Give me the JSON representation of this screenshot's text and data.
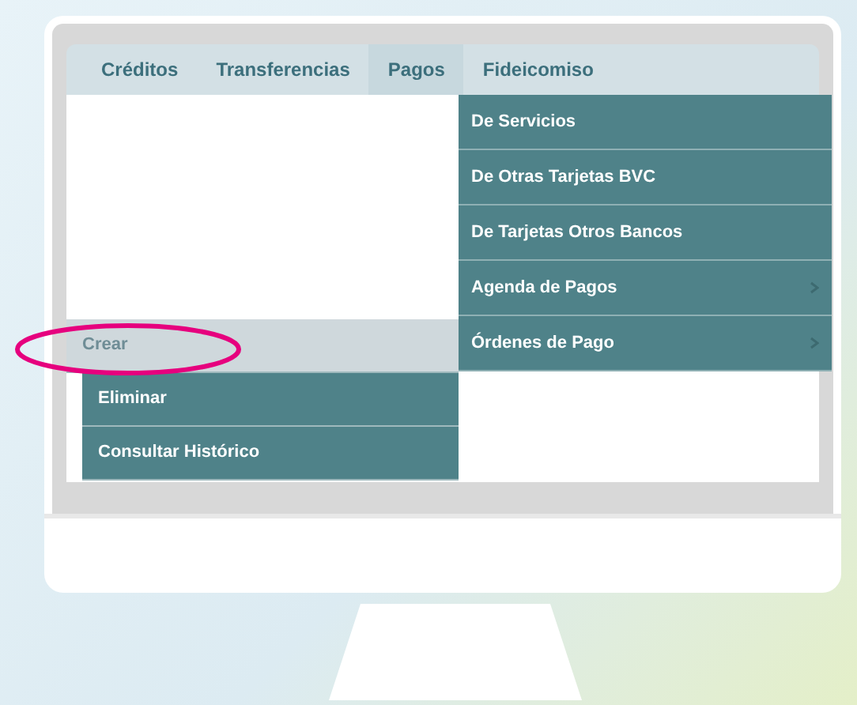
{
  "tabs": [
    {
      "label": "Créditos",
      "selected": false
    },
    {
      "label": "Transferencias",
      "selected": false
    },
    {
      "label": "Pagos",
      "selected": true
    },
    {
      "label": "Fideicomiso",
      "selected": false
    }
  ],
  "left_menu": [
    {
      "label": "Crear",
      "selected": true
    },
    {
      "label": "Eliminar",
      "selected": false
    },
    {
      "label": "Consultar Histórico",
      "selected": false
    }
  ],
  "submenu": [
    {
      "label": "De Servicios",
      "has_submenu": false
    },
    {
      "label": "De Otras Tarjetas BVC",
      "has_submenu": false
    },
    {
      "label": "De Tarjetas Otros Bancos",
      "has_submenu": false
    },
    {
      "label": "Agenda de Pagos",
      "has_submenu": true
    },
    {
      "label": "Órdenes de Pago",
      "has_submenu": true
    }
  ]
}
